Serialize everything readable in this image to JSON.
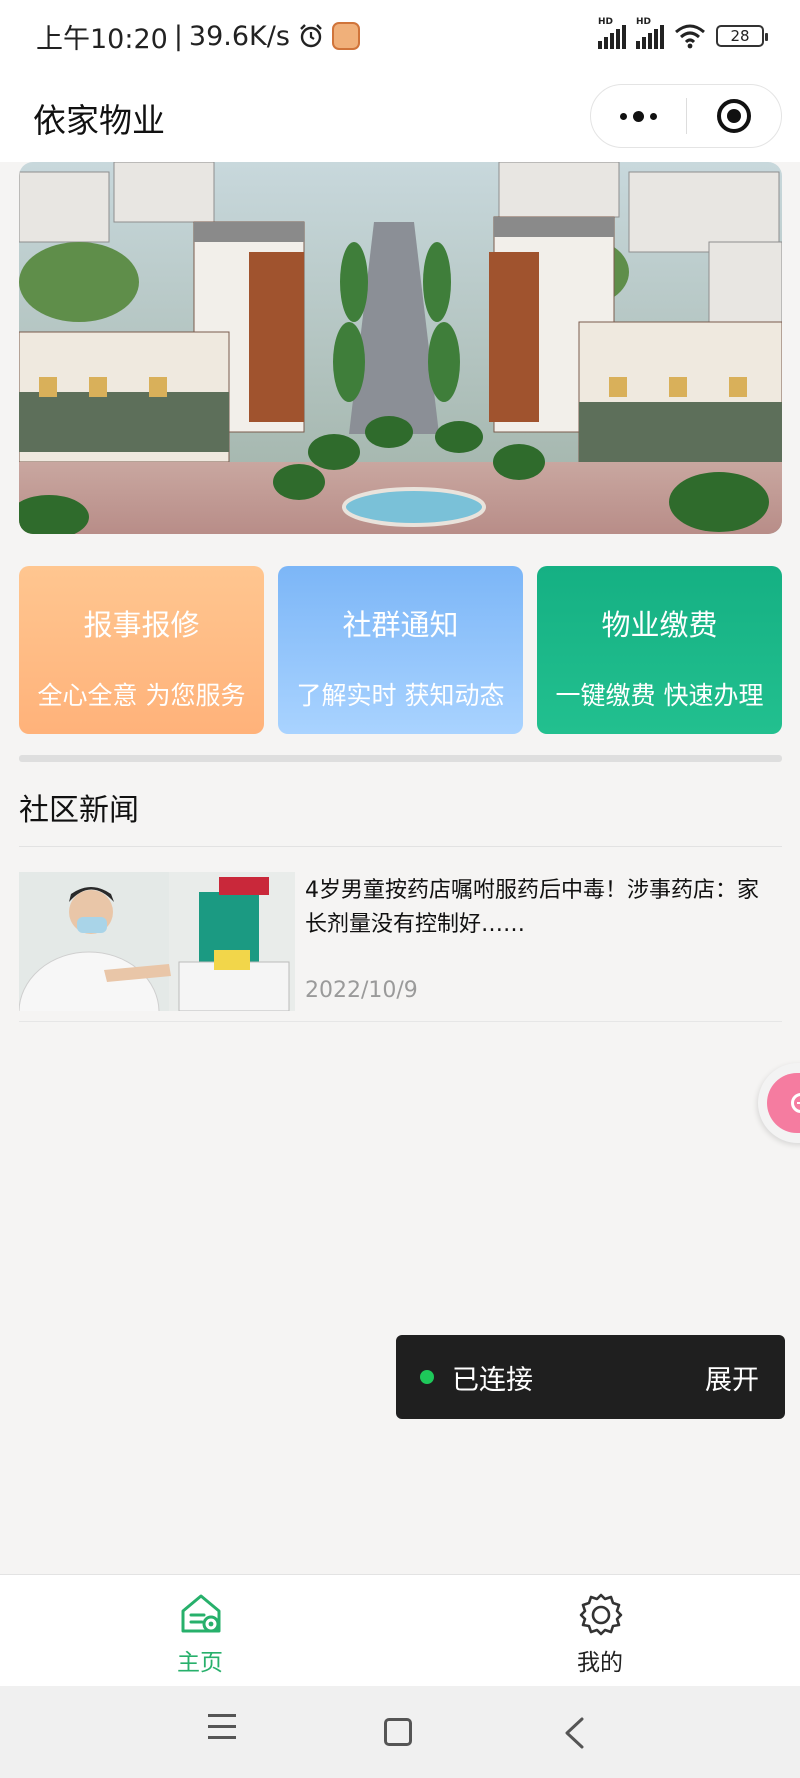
{
  "status_bar": {
    "time": "上午10:20",
    "speed": "39.6K/s",
    "hd_1": "HD",
    "hd_2": "HD",
    "battery": "28",
    "icons": [
      "alarm-icon",
      "app-notification-icon",
      "signal-icon",
      "signal-icon",
      "wifi-icon",
      "battery-icon"
    ]
  },
  "nav": {
    "title": "依家物业",
    "icons": [
      "more-icon",
      "close-miniprogram-icon"
    ]
  },
  "features": [
    {
      "title": "报事报修",
      "subtitle": "全心全意 为您服务",
      "color": "#ffb87f"
    },
    {
      "title": "社群通知",
      "subtitle": "了解实时 获知动态",
      "color": "#8cc2fb"
    },
    {
      "title": "物业缴费",
      "subtitle": "一键缴费 快速办理",
      "color": "#1ab586"
    }
  ],
  "news": {
    "heading": "社区新闻",
    "items": [
      {
        "title": "4岁男童按药店嘱咐服药后中毒！涉事药店：家长剂量没有控制好……",
        "date": "2022/10/9"
      }
    ]
  },
  "connection": {
    "status": "已连接",
    "expand": "展开",
    "status_color": "#1ec85a"
  },
  "tabs": [
    {
      "label": "主页",
      "icon": "home-icon",
      "active": true
    },
    {
      "label": "我的",
      "icon": "settings-icon",
      "active": false
    }
  ],
  "colors": {
    "accent": "#27b06b",
    "background": "#f5f4f3"
  }
}
